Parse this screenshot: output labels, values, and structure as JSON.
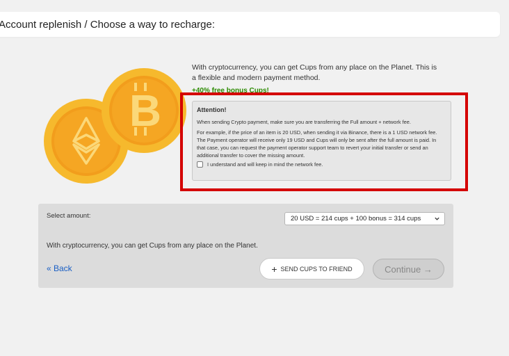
{
  "header": {
    "title": "Account replenish / Choose a way to recharge:"
  },
  "intro": {
    "description": "With cryptocurrency, you can get Cups from any place on the Planet. This is a flexible and modern payment method.",
    "bonus": "+40% free bonus Cups!"
  },
  "attention": {
    "title": "Attention!",
    "para1": "When sending Crypto payment, make sure you are transferring the Full amount + network fee.",
    "para2": "For example, if the price of an item is 20 USD, when sending it via Binance, there is a 1 USD network fee. The Payment operator will receive only 19 USD and Cups will only be sent after the full amount is paid. In that case, you can request the payment operator support team to revert your initial transfer or send an additional transfer to cover the missing amount.",
    "checkbox_label": "I understand and will keep in mind the network fee."
  },
  "panel": {
    "select_label": "Select amount:",
    "selected_option": "20 USD = 214 cups + 100 bonus = 314 cups",
    "note": "With cryptocurrency, you can get Cups from any place on the Planet.",
    "back": "« Back",
    "send": "SEND CUPS TO FRIEND",
    "continue": "Continue →"
  },
  "colors": {
    "highlight_frame": "#d40000",
    "bonus_text": "#2b8a00",
    "link": "#1a5fc4",
    "coin_gold": "#f5a623"
  },
  "icons": [
    "ethereum-coin-icon",
    "bitcoin-coin-icon",
    "chevron-down-icon",
    "plus-icon"
  ]
}
